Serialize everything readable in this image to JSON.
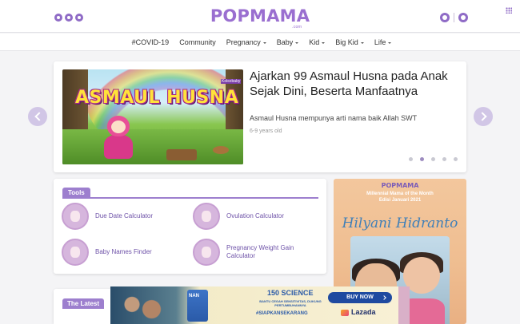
{
  "header": {
    "logo": "POPMAMA",
    "logo_sub": ".com",
    "social": [
      "facebook-icon",
      "twitter-icon",
      "instagram-icon"
    ],
    "icons": [
      "search-icon",
      "user-icon",
      "apps-grid-icon"
    ]
  },
  "nav": {
    "items": [
      {
        "label": "#COVID-19",
        "dropdown": false
      },
      {
        "label": "Community",
        "dropdown": false
      },
      {
        "label": "Pregnancy",
        "dropdown": true
      },
      {
        "label": "Baby",
        "dropdown": true
      },
      {
        "label": "Kid",
        "dropdown": true
      },
      {
        "label": "Big Kid",
        "dropdown": true
      },
      {
        "label": "Life",
        "dropdown": true
      }
    ]
  },
  "hero": {
    "image_caption": "ASMAUL HUSNA",
    "image_caption_small": "Kolezbaby",
    "title": "Ajarkan 99 Asmaul Husna pada Anak Sejak Dini, Beserta Manfaatnya",
    "description": "Asmaul Husna mempunya arti nama baik Allah SWT",
    "age": "6-9 years old",
    "slides": 5,
    "active_slide": 1
  },
  "tools": {
    "heading": "Tools",
    "items": [
      {
        "label": "Due Date Calculator",
        "icon": "pregnant-mother-icon"
      },
      {
        "label": "Ovulation Calculator",
        "icon": "ovulation-icon"
      },
      {
        "label": "Baby Names Finder",
        "icon": "baby-icon"
      },
      {
        "label": "Pregnancy Weight Gain Calculator",
        "icon": "weight-scale-icon"
      }
    ]
  },
  "promo": {
    "brand": "POPMAMA",
    "subtitle_line1": "Millennial Mama of the Month",
    "subtitle_line2": "Edisi Januari 2021",
    "name": "Hilyani Hidranto"
  },
  "latest": {
    "heading": "The Latest"
  },
  "ad": {
    "product": "NAN",
    "badge": "150 SCIENCE",
    "text": "BANTU CEGAH SENSITIVITAS, DUKUNG PERTUMBUHANNYA",
    "hashtag": "#SIAPKANSEKARANG",
    "cta": "BUY NOW",
    "store": "Lazada"
  },
  "colors": {
    "brand": "#9a6fd0",
    "tab": "#9d7fce",
    "arrow": "#d1c6e6"
  }
}
